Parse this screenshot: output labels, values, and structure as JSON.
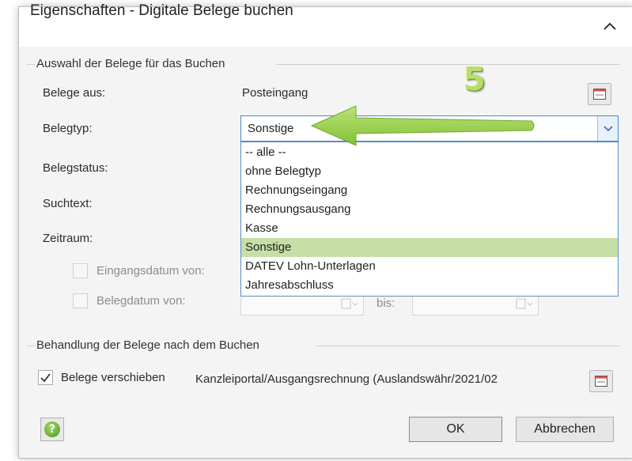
{
  "dialog": {
    "title": "Eigenschaften - Digitale Belege buchen"
  },
  "selection_section": {
    "label": "Auswahl der Belege für das Buchen",
    "belege_aus_label": "Belege aus:",
    "belege_aus_value": "Posteingang",
    "belegtyp_label": "Belegtyp:",
    "belegtyp_value": "Sonstige",
    "belegstatus_label": "Belegstatus:",
    "suchtext_label": "Suchtext:",
    "zeitraum_label": "Zeitraum:",
    "eingangsdatum_label": "Eingangsdatum von:",
    "belegdatum_label": "Belegdatum von:",
    "bis_label": "bis:",
    "eingangsdatum_checked": false,
    "belegdatum_checked": false
  },
  "belegtyp_dropdown": {
    "options": [
      "-- alle --",
      "ohne Belegtyp",
      "Rechnungseingang",
      "Rechnungsausgang",
      "Kasse",
      "Sonstige",
      "DATEV Lohn-Unterlagen",
      "Jahresabschluss"
    ],
    "selected_index": 5
  },
  "after_section": {
    "label": "Behandlung der Belege nach dem Buchen",
    "move_label": "Belege verschieben",
    "move_checked": true,
    "target_path": "Kanzleiportal/Ausgangsrechnung (Auslandswähr/2021/02"
  },
  "footer": {
    "ok_label": "OK",
    "cancel_label": "Abbrechen"
  },
  "annotation": {
    "step_number": "5",
    "color": "#8cc63f"
  }
}
